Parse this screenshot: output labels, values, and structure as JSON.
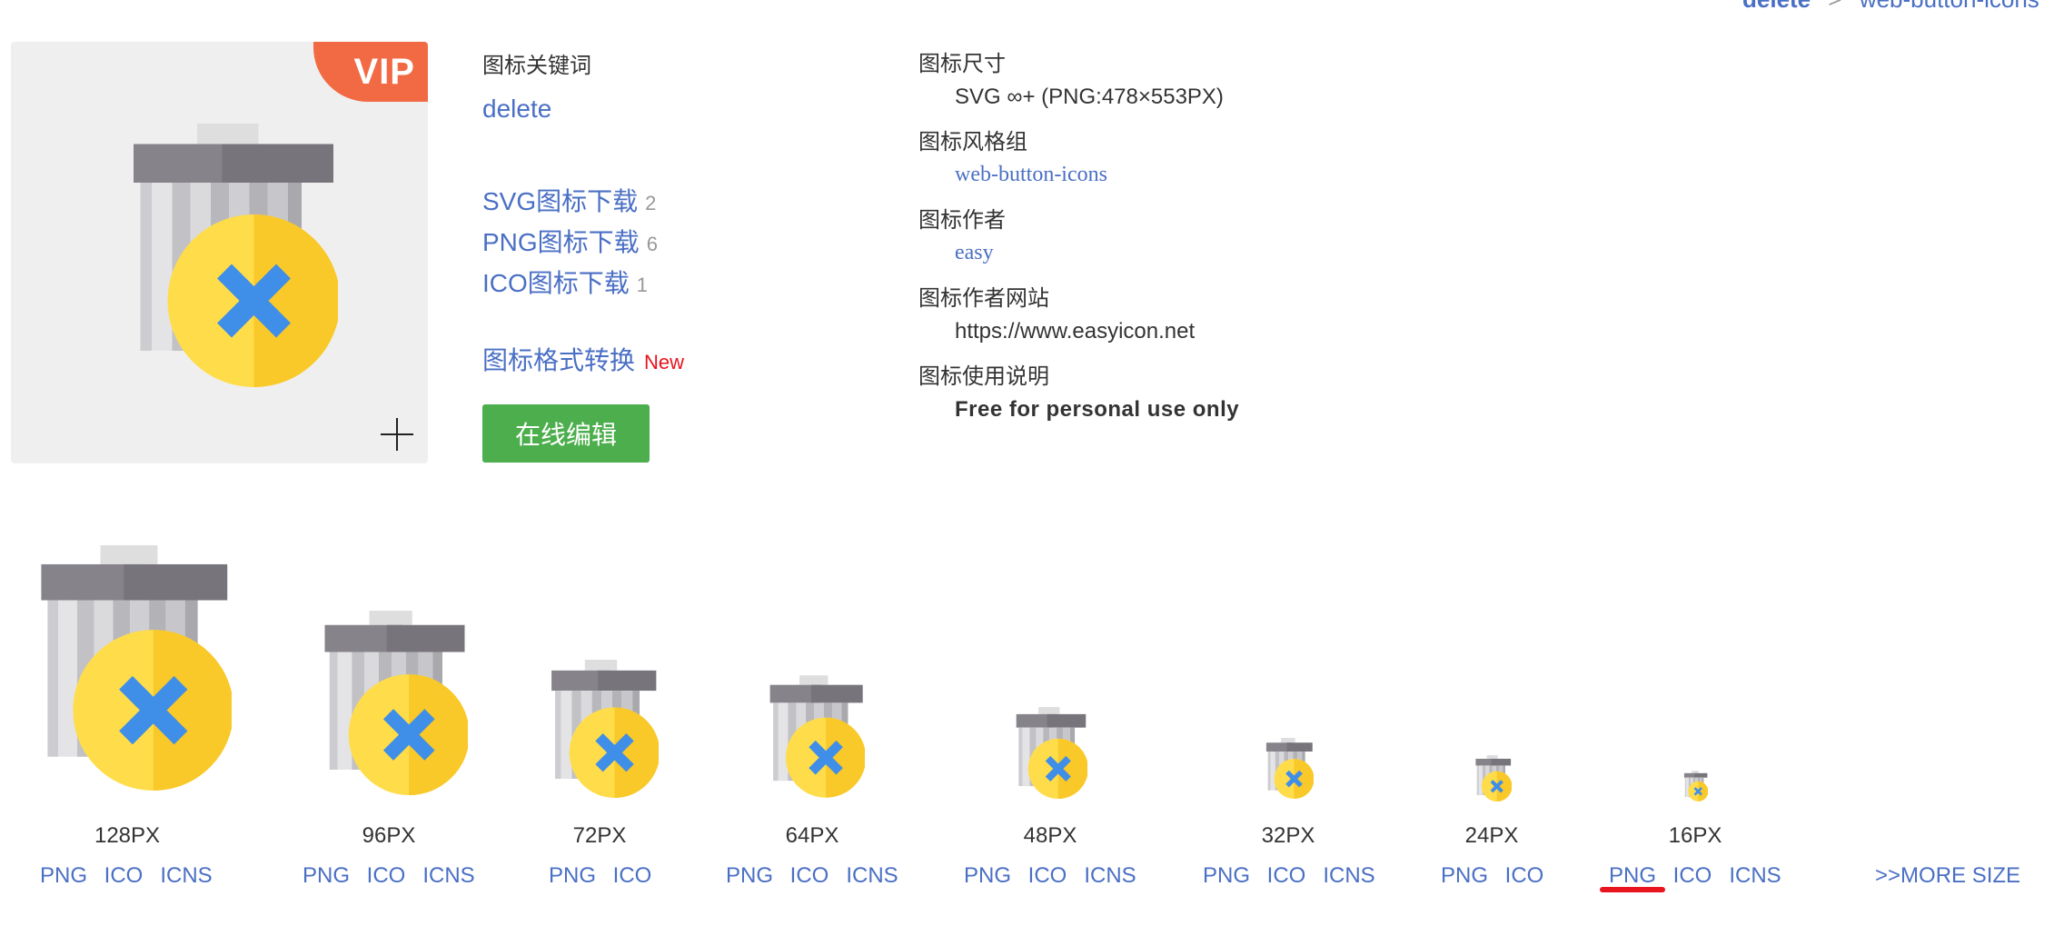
{
  "breadcrumb": {
    "current": "delete",
    "separator": ">",
    "next": "web-button-icons"
  },
  "badge": {
    "vip": "VIP"
  },
  "keywords": {
    "label": "图标关键词",
    "value": "delete"
  },
  "downloads": [
    {
      "label": "SVG图标下载",
      "count": "2"
    },
    {
      "label": "PNG图标下载",
      "count": "6"
    },
    {
      "label": "ICO图标下载",
      "count": "1"
    }
  ],
  "convert": {
    "label": "图标格式转换",
    "badge": "New"
  },
  "edit_button": "在线编辑",
  "info": {
    "size_label": "图标尺寸",
    "size_value": "SVG ∞+ (PNG:478×553PX)",
    "style_label": "图标风格组",
    "style_value": "web-button-icons",
    "author_label": "图标作者",
    "author_value": "easy",
    "site_label": "图标作者网站",
    "site_value": "https://www.easyicon.net",
    "usage_label": "图标使用说明",
    "usage_value": "Free for personal use only"
  },
  "sizes": [
    {
      "label": "128PX",
      "formats": [
        "PNG",
        "ICO",
        "ICNS"
      ]
    },
    {
      "label": "96PX",
      "formats": [
        "PNG",
        "ICO",
        "ICNS"
      ]
    },
    {
      "label": "72PX",
      "formats": [
        "PNG",
        "ICO"
      ]
    },
    {
      "label": "64PX",
      "formats": [
        "PNG",
        "ICO",
        "ICNS"
      ]
    },
    {
      "label": "48PX",
      "formats": [
        "PNG",
        "ICO",
        "ICNS"
      ]
    },
    {
      "label": "32PX",
      "formats": [
        "PNG",
        "ICO",
        "ICNS"
      ]
    },
    {
      "label": "24PX",
      "formats": [
        "PNG",
        "ICO"
      ]
    },
    {
      "label": "16PX",
      "formats": [
        "PNG",
        "ICO",
        "ICNS"
      ]
    }
  ],
  "more_size": ">>MORE SIZE",
  "colors": {
    "link": "#4a6fc4",
    "vip": "#f26a43",
    "edit_button": "#4cae4c",
    "new_badge": "#e8141e"
  },
  "icons": {
    "preview": "trash-delete-icon",
    "plus": "plus-icon"
  }
}
